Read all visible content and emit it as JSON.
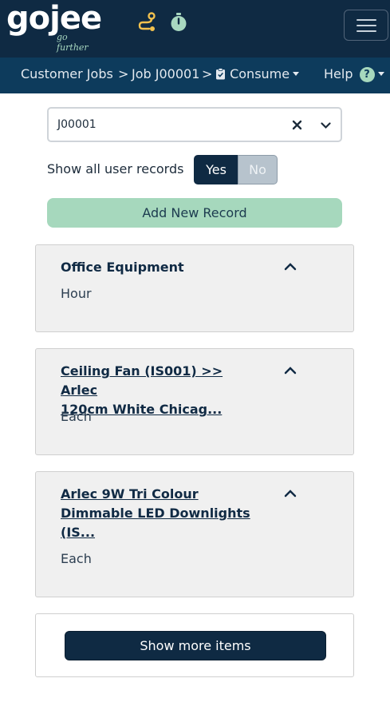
{
  "brand": {
    "name": "gojee",
    "tagline": "go further"
  },
  "topbar": {
    "icons": [
      "route-icon",
      "stopwatch-icon"
    ],
    "menu_icon": "hamburger-menu-icon"
  },
  "breadcrumb": {
    "items": [
      "Customer Jobs",
      "Job J00001",
      "Consume"
    ],
    "separator": ">",
    "help_label": "Help",
    "help_badge": "?"
  },
  "job_select": {
    "value": "J00001"
  },
  "show_records": {
    "label": "Show all user records",
    "yes_label": "Yes",
    "no_label": "No",
    "selected": "Yes"
  },
  "add_button": {
    "label": "Add New Record"
  },
  "records": [
    {
      "title": "Office Equipment",
      "unit": "Hour",
      "linked": false
    },
    {
      "title_lines": [
        "Ceiling Fan (IS001) >> Arlec",
        "120cm White Chicag..."
      ],
      "unit": "Each",
      "linked": true
    },
    {
      "title_lines": [
        "Arlec 9W Tri Colour",
        "Dimmable LED Downlights",
        "(IS..."
      ],
      "unit": "Each",
      "linked": true
    }
  ],
  "show_more": {
    "label": "Show more items"
  },
  "colors": {
    "topbar_bg": "#0f2a43",
    "navbar_bg": "#0d3b5c",
    "accent_yellow": "#f2c14e",
    "accent_green": "#a6d8bd",
    "dark_button": "#0f2a43",
    "card_bg": "#f0f0f0"
  }
}
